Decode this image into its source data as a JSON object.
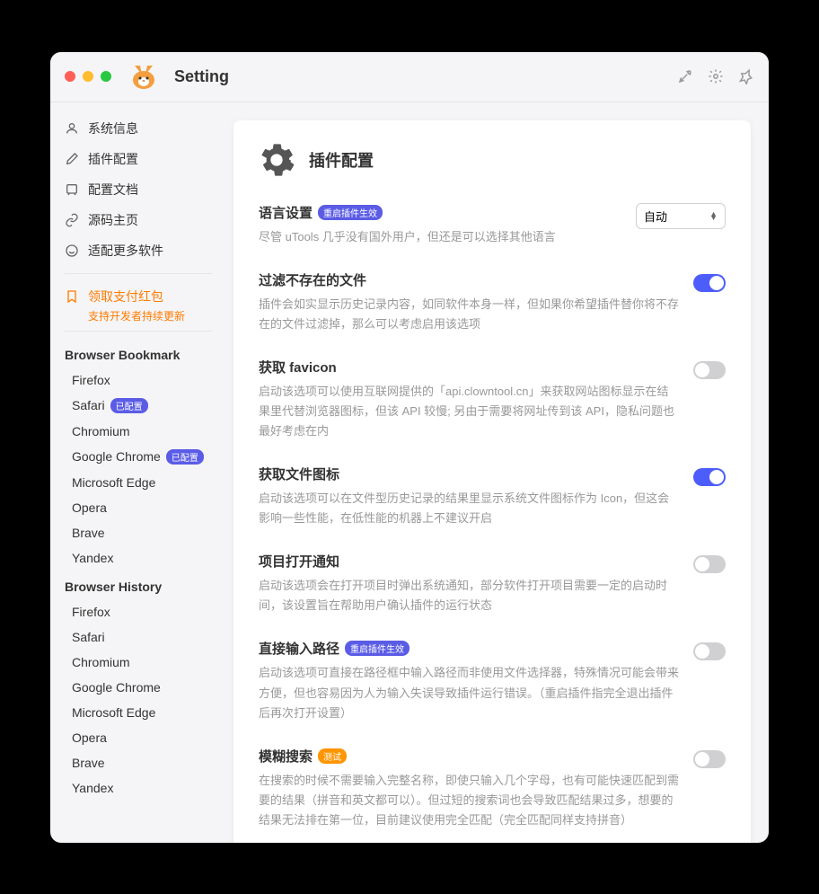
{
  "window": {
    "title": "Setting"
  },
  "sidebar": {
    "nav": [
      {
        "label": "系统信息"
      },
      {
        "label": "插件配置"
      },
      {
        "label": "配置文档"
      },
      {
        "label": "源码主页"
      },
      {
        "label": "适配更多软件"
      }
    ],
    "promo": {
      "title": "领取支付红包",
      "subtitle": "支持开发者持续更新"
    },
    "sections": {
      "bookmark": {
        "header": "Browser Bookmark",
        "items": [
          {
            "label": "Firefox",
            "badge": ""
          },
          {
            "label": "Safari",
            "badge": "已配置"
          },
          {
            "label": "Chromium",
            "badge": ""
          },
          {
            "label": "Google Chrome",
            "badge": "已配置"
          },
          {
            "label": "Microsoft Edge",
            "badge": ""
          },
          {
            "label": "Opera",
            "badge": ""
          },
          {
            "label": "Brave",
            "badge": ""
          },
          {
            "label": "Yandex",
            "badge": ""
          }
        ]
      },
      "history": {
        "header": "Browser History",
        "items": [
          {
            "label": "Firefox"
          },
          {
            "label": "Safari"
          },
          {
            "label": "Chromium"
          },
          {
            "label": "Google Chrome"
          },
          {
            "label": "Microsoft Edge"
          },
          {
            "label": "Opera"
          },
          {
            "label": "Brave"
          },
          {
            "label": "Yandex"
          }
        ]
      }
    }
  },
  "main": {
    "title": "插件配置",
    "settings": [
      {
        "title": "语言设置",
        "tag": "重启插件生效",
        "tagColor": "purple",
        "desc": "尽管 uTools 几乎没有国外用户，但还是可以选择其他语言",
        "control": "select",
        "value": "自动"
      },
      {
        "title": "过滤不存在的文件",
        "desc": "插件会如实显示历史记录内容，如同软件本身一样，但如果你希望插件替你将不存在的文件过滤掉，那么可以考虑启用该选项",
        "control": "toggle",
        "on": true
      },
      {
        "title": "获取 favicon",
        "desc": "启动该选项可以使用互联网提供的「api.clowntool.cn」来获取网站图标显示在结果里代替浏览器图标，但该 API 较慢; 另由于需要将网址传到该 API，隐私问题也最好考虑在内",
        "control": "toggle",
        "on": false
      },
      {
        "title": "获取文件图标",
        "desc": "启动该选项可以在文件型历史记录的结果里显示系统文件图标作为 Icon，但这会影响一些性能，在低性能的机器上不建议开启",
        "control": "toggle",
        "on": true
      },
      {
        "title": "项目打开通知",
        "desc": "启动该选项会在打开项目时弹出系统通知，部分软件打开项目需要一定的启动时间，该设置旨在帮助用户确认插件的运行状态",
        "control": "toggle",
        "on": false
      },
      {
        "title": "直接输入路径",
        "tag": "重启插件生效",
        "tagColor": "purple",
        "desc": "启动该选项可直接在路径框中输入路径而非使用文件选择器，特殊情况可能会带来方便，但也容易因为人为输入失误导致插件运行错误。（重启插件指完全退出插件后再次打开设置）",
        "control": "toggle",
        "on": false
      },
      {
        "title": "模糊搜索",
        "tag": "测试",
        "tagColor": "orange",
        "desc": "在搜索的时候不需要输入完整名称，即使只输入几个字母，也有可能快速匹配到需要的结果（拼音和英文都可以）。但过短的搜索词也会导致匹配结果过多，想要的结果无法排在第一位，目前建议使用完全匹配（完全匹配同样支持拼音）",
        "control": "toggle",
        "on": false
      }
    ]
  }
}
